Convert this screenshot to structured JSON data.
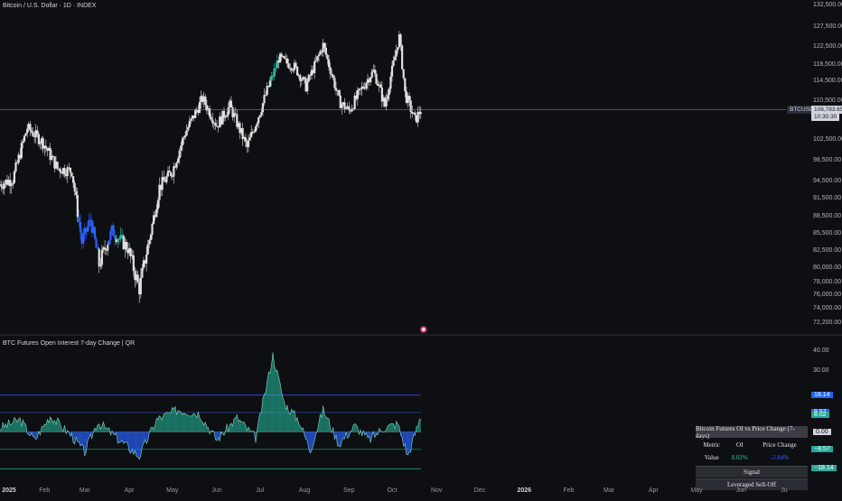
{
  "header": {
    "symbol": "Bitcoin / U.S. Dollar · 1D · INDEX",
    "indicator": "BTC Futures Open Interest 7-day Change | QR"
  },
  "price_axis": {
    "ticks": [
      "132,500.00",
      "127,500.00",
      "122,500.00",
      "118,500.00",
      "114,500.00",
      "110,500.00",
      "102,500.00",
      "98,500.00",
      "94,500.00",
      "91,500.00",
      "88,500.00",
      "85,500.00",
      "82,500.00",
      "80,000.00",
      "78,000.00",
      "76,000.00",
      "74,000.00",
      "72,200.00"
    ],
    "tick_values": [
      132500,
      127500,
      122500,
      118500,
      114500,
      110500,
      102500,
      98500,
      94500,
      91500,
      88500,
      85500,
      82500,
      80000,
      78000,
      76000,
      74000,
      72200
    ],
    "last_symbol": "BTCUSD",
    "last_price": "108,783.65",
    "countdown": "10:30:30"
  },
  "osc_axis": {
    "ticks": [
      "40.00",
      "30.00",
      "0.00"
    ],
    "tick_values": [
      40,
      30,
      0
    ],
    "tag_values": [
      {
        "text": "18.14",
        "value": 18.14,
        "color": "#2962ff"
      },
      {
        "text": "9.57",
        "value": 9.57,
        "color": "#2962ff"
      },
      {
        "text": "8.02",
        "value": 8.02,
        "color": "#26a69a"
      },
      {
        "text": "−8.57",
        "value": -8.57,
        "color": "#26a69a"
      },
      {
        "text": "−18.14",
        "value": -18.14,
        "color": "#26a69a"
      }
    ]
  },
  "time_axis": {
    "labels": [
      "2025",
      "Feb",
      "Mar",
      "Apr",
      "May",
      "Jun",
      "Jul",
      "Aug",
      "Sep",
      "Oct",
      "Nov",
      "Dec",
      "2026",
      "Feb",
      "Mar",
      "Apr",
      "May",
      "Jun",
      "Ju"
    ]
  },
  "panel": {
    "title": "Bitcoin Futures OI vs Price Change (7-days)",
    "col_metric": "Metric",
    "col_oi": "OI",
    "col_price": "Price Change",
    "row_label": "Value",
    "oi_value": "8.02%",
    "price_value": "-3.84%",
    "signal_label": "Signal",
    "signal_value": "Leveraged Sell-Off"
  },
  "colors": {
    "background": "#0e0f12",
    "candle": "#e0e0e0",
    "teal": "#26c6a6",
    "blue": "#2962ff",
    "band": "#2f4bd6",
    "green_band": "#1e9e7a"
  },
  "chart_data": [
    {
      "type": "candlestick",
      "title": "Bitcoin / U.S. Dollar · 1D · INDEX",
      "ylim": [
        72200,
        132500
      ],
      "x_range": [
        "2025-01-01",
        "2026-07-01"
      ],
      "anchors": [
        {
          "date": "2025-01-01",
          "close": 94000
        },
        {
          "date": "2025-01-10",
          "close": 95000
        },
        {
          "date": "2025-01-20",
          "close": 105000
        },
        {
          "date": "2025-01-31",
          "close": 102000
        },
        {
          "date": "2025-02-10",
          "close": 97000
        },
        {
          "date": "2025-02-20",
          "close": 96500
        },
        {
          "date": "2025-02-27",
          "close": 84000
        },
        {
          "date": "2025-03-05",
          "close": 88000
        },
        {
          "date": "2025-03-11",
          "close": 80500
        },
        {
          "date": "2025-03-20",
          "close": 86000
        },
        {
          "date": "2025-03-31",
          "close": 83000
        },
        {
          "date": "2025-04-08",
          "close": 77000
        },
        {
          "date": "2025-04-15",
          "close": 84500
        },
        {
          "date": "2025-04-22",
          "close": 93500
        },
        {
          "date": "2025-05-01",
          "close": 96500
        },
        {
          "date": "2025-05-10",
          "close": 104000
        },
        {
          "date": "2025-05-22",
          "close": 111000
        },
        {
          "date": "2025-06-01",
          "close": 105500
        },
        {
          "date": "2025-06-10",
          "close": 109500
        },
        {
          "date": "2025-06-22",
          "close": 101000
        },
        {
          "date": "2025-06-30",
          "close": 107500
        },
        {
          "date": "2025-07-10",
          "close": 116000
        },
        {
          "date": "2025-07-14",
          "close": 120000
        },
        {
          "date": "2025-07-25",
          "close": 118000
        },
        {
          "date": "2025-08-02",
          "close": 113500
        },
        {
          "date": "2025-08-14",
          "close": 123000
        },
        {
          "date": "2025-08-25",
          "close": 110500
        },
        {
          "date": "2025-09-01",
          "close": 108500
        },
        {
          "date": "2025-09-10",
          "close": 113000
        },
        {
          "date": "2025-09-18",
          "close": 117000
        },
        {
          "date": "2025-09-26",
          "close": 109500
        },
        {
          "date": "2025-10-06",
          "close": 125000
        },
        {
          "date": "2025-10-10",
          "close": 112000
        },
        {
          "date": "2025-10-17",
          "close": 106500
        },
        {
          "date": "2025-10-21",
          "close": 108783.65
        }
      ]
    },
    {
      "type": "area",
      "title": "BTC Futures Open Interest 7-day Change | QR",
      "ylim": [
        -22,
        42
      ],
      "upper_band": 18.14,
      "lower_band": -18.14,
      "inner_upper": 9.57,
      "inner_lower": -8.57,
      "zero": 0,
      "anchors": [
        {
          "date": "2025-01-01",
          "value": 2
        },
        {
          "date": "2025-01-15",
          "value": 6
        },
        {
          "date": "2025-01-25",
          "value": -4
        },
        {
          "date": "2025-02-05",
          "value": 8
        },
        {
          "date": "2025-02-20",
          "value": -2
        },
        {
          "date": "2025-03-01",
          "value": -10
        },
        {
          "date": "2025-03-10",
          "value": 5
        },
        {
          "date": "2025-03-25",
          "value": -4
        },
        {
          "date": "2025-04-08",
          "value": -12
        },
        {
          "date": "2025-04-20",
          "value": 6
        },
        {
          "date": "2025-05-05",
          "value": 11
        },
        {
          "date": "2025-05-20",
          "value": 9
        },
        {
          "date": "2025-06-01",
          "value": -4
        },
        {
          "date": "2025-06-15",
          "value": 7
        },
        {
          "date": "2025-06-28",
          "value": -3
        },
        {
          "date": "2025-07-10",
          "value": 38
        },
        {
          "date": "2025-07-18",
          "value": 14
        },
        {
          "date": "2025-07-28",
          "value": 6
        },
        {
          "date": "2025-08-05",
          "value": -9
        },
        {
          "date": "2025-08-14",
          "value": 11
        },
        {
          "date": "2025-08-25",
          "value": -6
        },
        {
          "date": "2025-09-05",
          "value": 3
        },
        {
          "date": "2025-09-15",
          "value": -4
        },
        {
          "date": "2025-09-25",
          "value": 2
        },
        {
          "date": "2025-10-05",
          "value": 4
        },
        {
          "date": "2025-10-12",
          "value": -12
        },
        {
          "date": "2025-10-21",
          "value": 8.02
        }
      ]
    }
  ]
}
